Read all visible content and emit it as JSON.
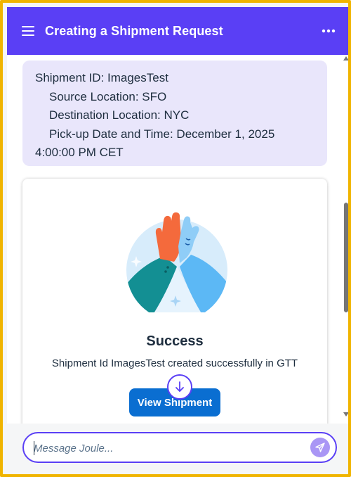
{
  "header": {
    "title": "Creating a Shipment Request",
    "menu_icon": "hamburger-menu-icon",
    "more_icon": "more-options-icon",
    "background_color": "#5a3ff5"
  },
  "message": {
    "lines": [
      "Shipment ID: ImagesTest",
      "Source Location: SFO",
      "Destination Location: NYC",
      "Pick-up Date and Time: December 1, 2025",
      "4:00:00 PM CET"
    ],
    "background_color": "#e9e6fb"
  },
  "success_card": {
    "illustration": "high-five-illustration",
    "title": "Success",
    "text": "Shipment Id ImagesTest created successfully in GTT",
    "button_label": "View Shipment",
    "button_color": "#0a6ed1"
  },
  "scroll_down_icon": "arrow-down-icon",
  "composer": {
    "placeholder": "Message Joule...",
    "value": "",
    "send_icon": "send-icon",
    "accent_color": "#5a3ff5"
  },
  "frame_color": "#f0b400"
}
